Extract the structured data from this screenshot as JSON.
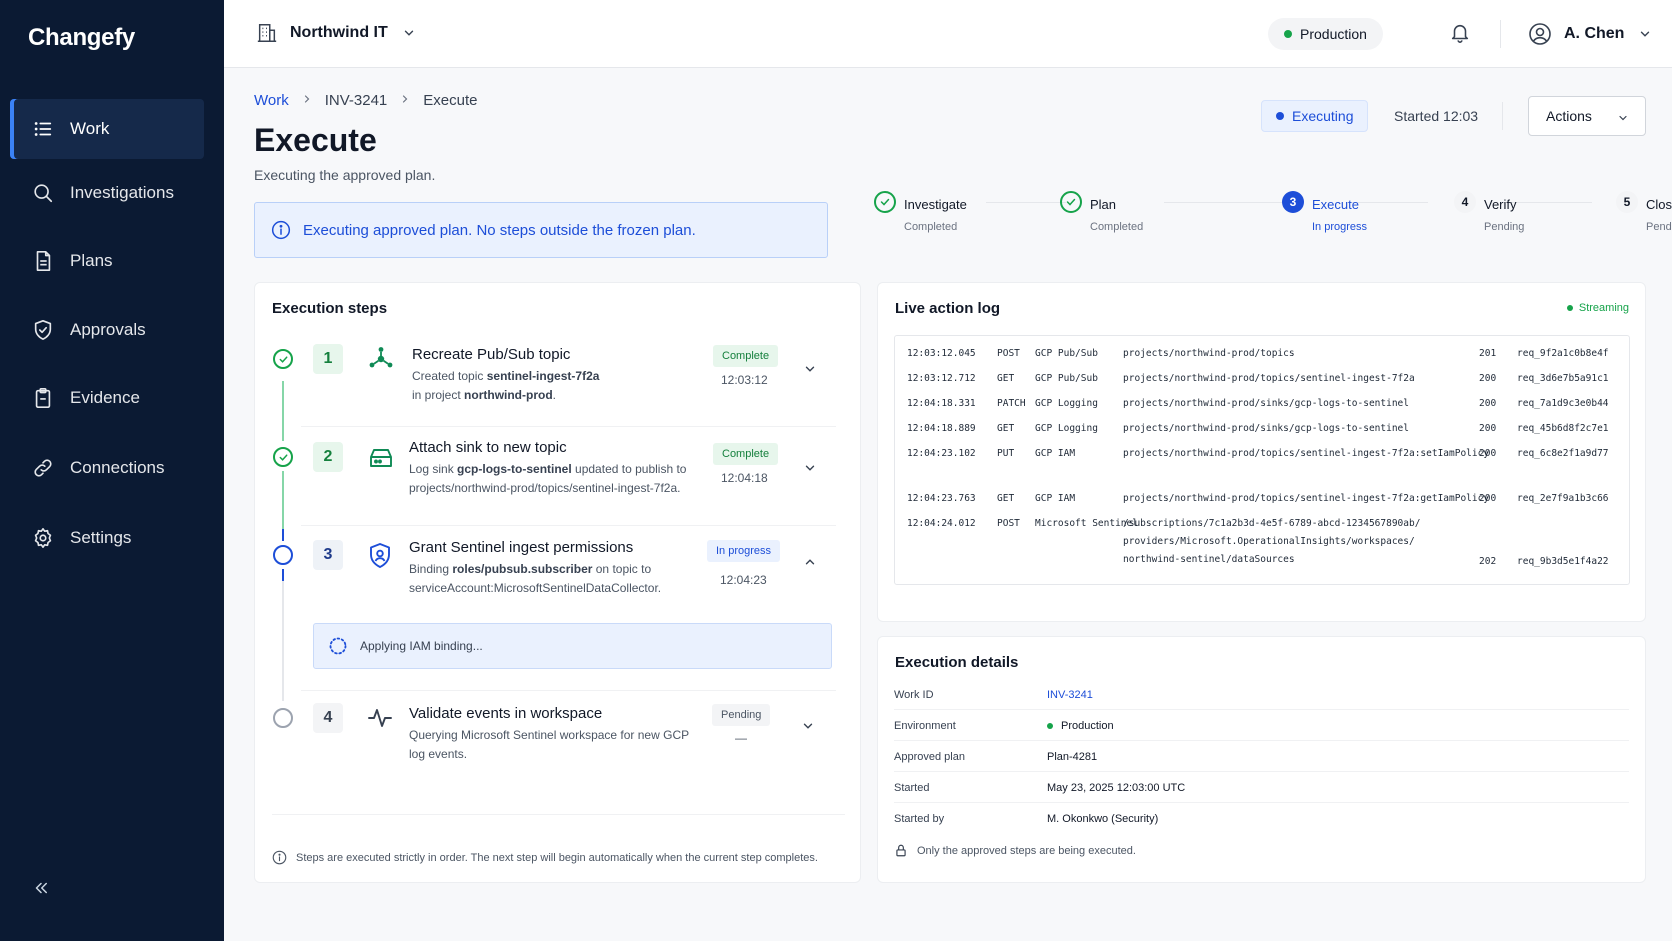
{
  "app": {
    "name": "Changefy"
  },
  "sidebar": {
    "items": [
      {
        "label": "Work",
        "icon": "list-icon",
        "active": true
      },
      {
        "label": "Investigations",
        "icon": "search-icon"
      },
      {
        "label": "Plans",
        "icon": "document-icon"
      },
      {
        "label": "Approvals",
        "icon": "shield-check-icon"
      },
      {
        "label": "Evidence",
        "icon": "clipboard-icon"
      },
      {
        "label": "Connections",
        "icon": "link-icon"
      },
      {
        "label": "Settings",
        "icon": "gear-icon"
      }
    ],
    "collapse_icon": "double-chevron-left-icon"
  },
  "topbar": {
    "org": "Northwind IT",
    "environment": "Production",
    "user": "A. Chen"
  },
  "page": {
    "breadcrumb": [
      "Work",
      "INV-3241",
      "Execute"
    ],
    "title": "Execute",
    "subtitle": "Executing the approved plan.",
    "status": "Executing",
    "started": "Started 12:03",
    "actions_label": "Actions",
    "banner": "Executing approved plan. No steps outside the frozen plan."
  },
  "stepper": [
    {
      "label": "Investigate",
      "status": "Completed",
      "state": "done"
    },
    {
      "label": "Plan",
      "status": "Completed",
      "state": "done"
    },
    {
      "num": "3",
      "label": "Execute",
      "status": "In progress",
      "state": "current"
    },
    {
      "num": "4",
      "label": "Verify",
      "status": "Pending",
      "state": "pending"
    },
    {
      "num": "5",
      "label": "Close",
      "status": "Pending",
      "state": "pending"
    }
  ],
  "execution_steps": {
    "title": "Execution steps",
    "steps": [
      {
        "num": "1",
        "name": "Recreate Pub/Sub topic",
        "desc_pre": "Created topic ",
        "desc_bold": "sentinel-ingest-7f2a",
        "desc_mid": " in project ",
        "desc_bold2": "northwind-prod",
        "desc_end": ".",
        "badge": "Complete",
        "time": "12:03:12"
      },
      {
        "num": "2",
        "name": "Attach sink to new topic",
        "desc_pre": "Log sink ",
        "desc_bold": "gcp-logs-to-sentinel",
        "desc_mid": " updated to publish to projects/northwind-prod/topics/sentinel-ingest-7f2a.",
        "badge": "Complete",
        "time": "12:04:18"
      },
      {
        "num": "3",
        "name": "Grant Sentinel ingest permissions",
        "desc_pre": "Binding ",
        "desc_bold": "roles/pubsub.subscriber",
        "desc_mid": " on topic to serviceAccount:MicrosoftSentinelDataCollector.",
        "badge": "In progress",
        "time": "12:04:23"
      },
      {
        "num": "4",
        "name": "Validate events in workspace",
        "desc_pre": "Querying Microsoft Sentinel workspace for new GCP log events.",
        "badge": "Pending",
        "time": "—"
      }
    ],
    "applying": "Applying IAM binding...",
    "footer": "Steps are executed strictly in order. The next step will begin automatically when the current step completes."
  },
  "live_log": {
    "title": "Live action log",
    "streaming": "Streaming",
    "rows": [
      {
        "time": "12:03:12.045",
        "method": "POST",
        "service": "GCP Pub/Sub",
        "path": "projects/northwind-prod/topics",
        "code": "201",
        "req": "req_9f2a1c0b8e4f"
      },
      {
        "time": "12:03:12.712",
        "method": "GET",
        "service": "GCP Pub/Sub",
        "path": "projects/northwind-prod/topics/sentinel-ingest-7f2a",
        "code": "200",
        "req": "req_3d6e7b5a91c1"
      },
      {
        "time": "12:04:18.331",
        "method": "PATCH",
        "service": "GCP Logging",
        "path": "projects/northwind-prod/sinks/gcp-logs-to-sentinel",
        "code": "200",
        "req": "req_7a1d9c3e0b44"
      },
      {
        "time": "12:04:18.889",
        "method": "GET",
        "service": "GCP Logging",
        "path": "projects/northwind-prod/sinks/gcp-logs-to-sentinel",
        "code": "200",
        "req": "req_45b6d8f2c7e1"
      },
      {
        "time": "12:04:23.102",
        "method": "PUT",
        "service": "GCP IAM",
        "path": "projects/northwind-prod/topics/sentinel-ingest-7f2a:setIamPolicy",
        "code": "200",
        "req": "req_6c8e2f1a9d77"
      },
      {
        "time": "12:04:23.763",
        "method": "GET",
        "service": "GCP IAM",
        "path": "projects/northwind-prod/topics/sentinel-ingest-7f2a:getIamPolicy",
        "code": "200",
        "req": "req_2e7f9a1b3c66"
      },
      {
        "time": "12:04:24.012",
        "method": "POST",
        "service": "Microsoft Sentinel",
        "path": "/subscriptions/7c1a2b3d-4e5f-6789-abcd-1234567890ab/",
        "path2": "providers/Microsoft.OperationalInsights/workspaces/",
        "path3": "northwind-sentinel/dataSources",
        "code": "202",
        "req": "req_9b3d5e1f4a22"
      }
    ]
  },
  "details": {
    "title": "Execution details",
    "rows": [
      {
        "key": "Work ID",
        "value": "INV-3241"
      },
      {
        "key": "Environment",
        "value": "Production"
      },
      {
        "key": "Approved plan",
        "value": "Plan-4281"
      },
      {
        "key": "Started",
        "value": "May 23, 2025 12:03:00 UTC"
      },
      {
        "key": "Started by",
        "value": "M. Okonkwo (Security)"
      }
    ],
    "note": "Only the approved steps are being executed."
  },
  "colors": {
    "sidebar_bg": "#0b1a33",
    "accent": "#1d4ed8",
    "success": "#16a34a",
    "pending": "#6b7280"
  }
}
